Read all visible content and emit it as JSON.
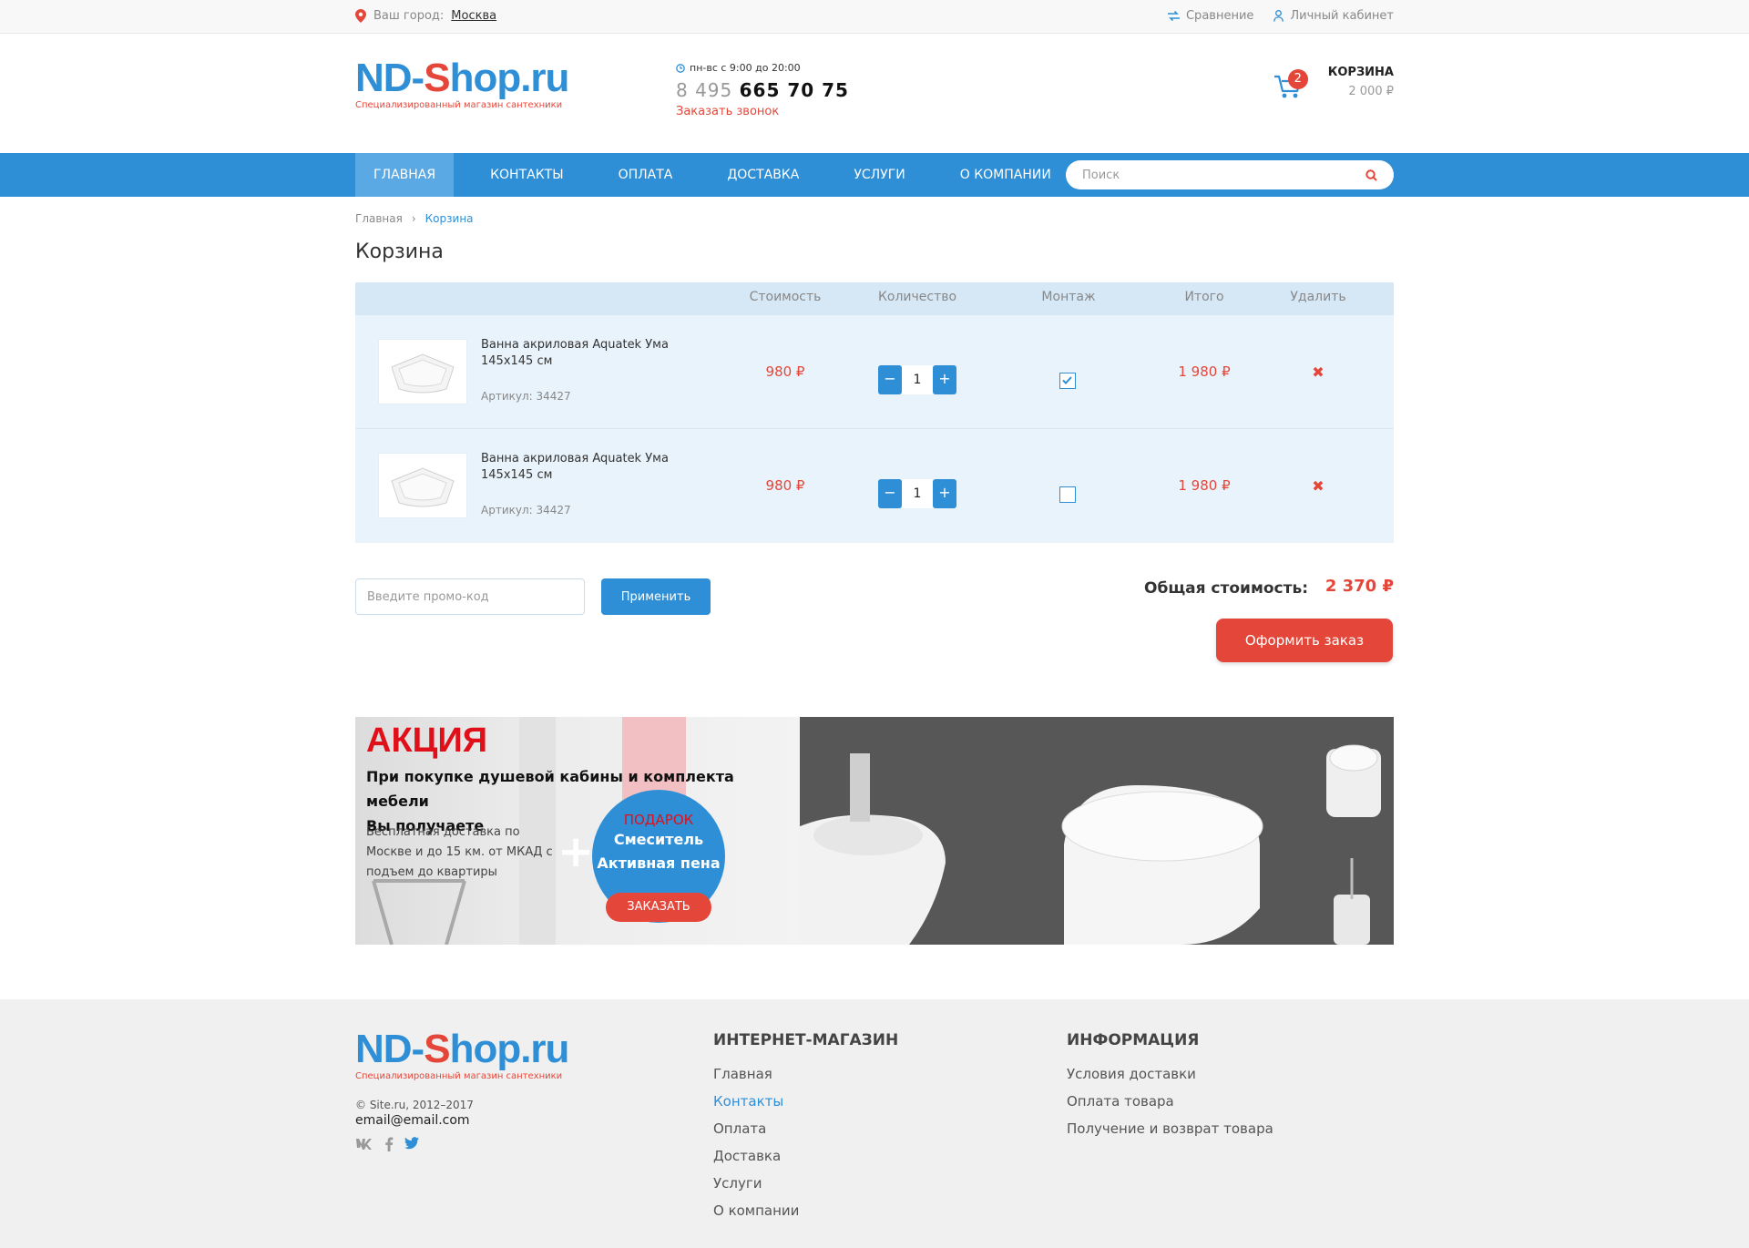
{
  "topbar": {
    "city_label": "Ваш город:",
    "city_name": "Москва",
    "compare": "Сравнение",
    "account": "Личный кабинет"
  },
  "header": {
    "logo_part1": "N",
    "logo_part2": "D-",
    "logo_part3": "S",
    "logo_part4": "hop.ru",
    "logo_sub": "Специализированный магазин сантехники",
    "hours": "пн-вс с 9:00 до 20:00",
    "phone_code": "8 495",
    "phone_number": "665 70 75",
    "callback": "Заказать звонок",
    "cart_title": "КОРЗИНА",
    "cart_sum": "2 000 ₽",
    "cart_count": "2"
  },
  "nav": {
    "items": [
      "ГЛАВНАЯ",
      "КОНТАКТЫ",
      "ОПЛАТА",
      "ДОСТАВКА",
      "УСЛУГИ",
      "О КОМПАНИИ"
    ],
    "active_index": 0,
    "search_placeholder": "Поиск"
  },
  "breadcrumb": {
    "home": "Главная",
    "sep": "›",
    "current": "Корзина"
  },
  "page_title": "Корзина",
  "table": {
    "headers": {
      "price": "Стоимость",
      "qty": "Количество",
      "mount": "Монтаж",
      "total": "Итого",
      "remove": "Удалить"
    },
    "rows": [
      {
        "name": "Ванна акриловая Aquatek Ума 145х145 см",
        "sku": "Артикул: 34427",
        "price": "980 ₽",
        "qty": "1",
        "mount": true,
        "total": "1 980 ₽"
      },
      {
        "name": "Ванна акриловая Aquatek Ума 145х145 см",
        "sku": "Артикул: 34427",
        "price": "980 ₽",
        "qty": "1",
        "mount": false,
        "total": "1 980 ₽"
      }
    ]
  },
  "promo": {
    "placeholder": "Введите промо-код",
    "apply": "Применить"
  },
  "summary": {
    "label": "Общая стоимость:",
    "value": "2 370 ₽",
    "checkout": "Оформить заказ"
  },
  "banner": {
    "title": "АКЦИЯ",
    "subtitle_1": "При покупке душевой кабины и комплекта мебели",
    "subtitle_2": "Вы получаете",
    "text": "Бесплатная доставка по Москве и до 15 км. от МКАД с подъем до квартиры",
    "gift": "ПОДАРОК",
    "gift_1": "Смеситель",
    "gift_2": "Активная пена",
    "order": "ЗАКАЗАТЬ"
  },
  "footer": {
    "copyright": "© Site.ru, 2012–2017",
    "email": "email@email.com",
    "col1_title": "ИНТЕРНЕТ-МАГАЗИН",
    "col1_links": [
      "Главная",
      "Контакты",
      "Оплата",
      "Доставка",
      "Услуги",
      "О компании"
    ],
    "col2_title": "ИНФОРМАЦИЯ",
    "col2_links": [
      "Условия доставки",
      "Оплата товара",
      "Получение и возврат товара"
    ]
  },
  "colors": {
    "accent": "#2e8fd7",
    "danger": "#e4473a",
    "row_bg": "#e9f3fb"
  }
}
